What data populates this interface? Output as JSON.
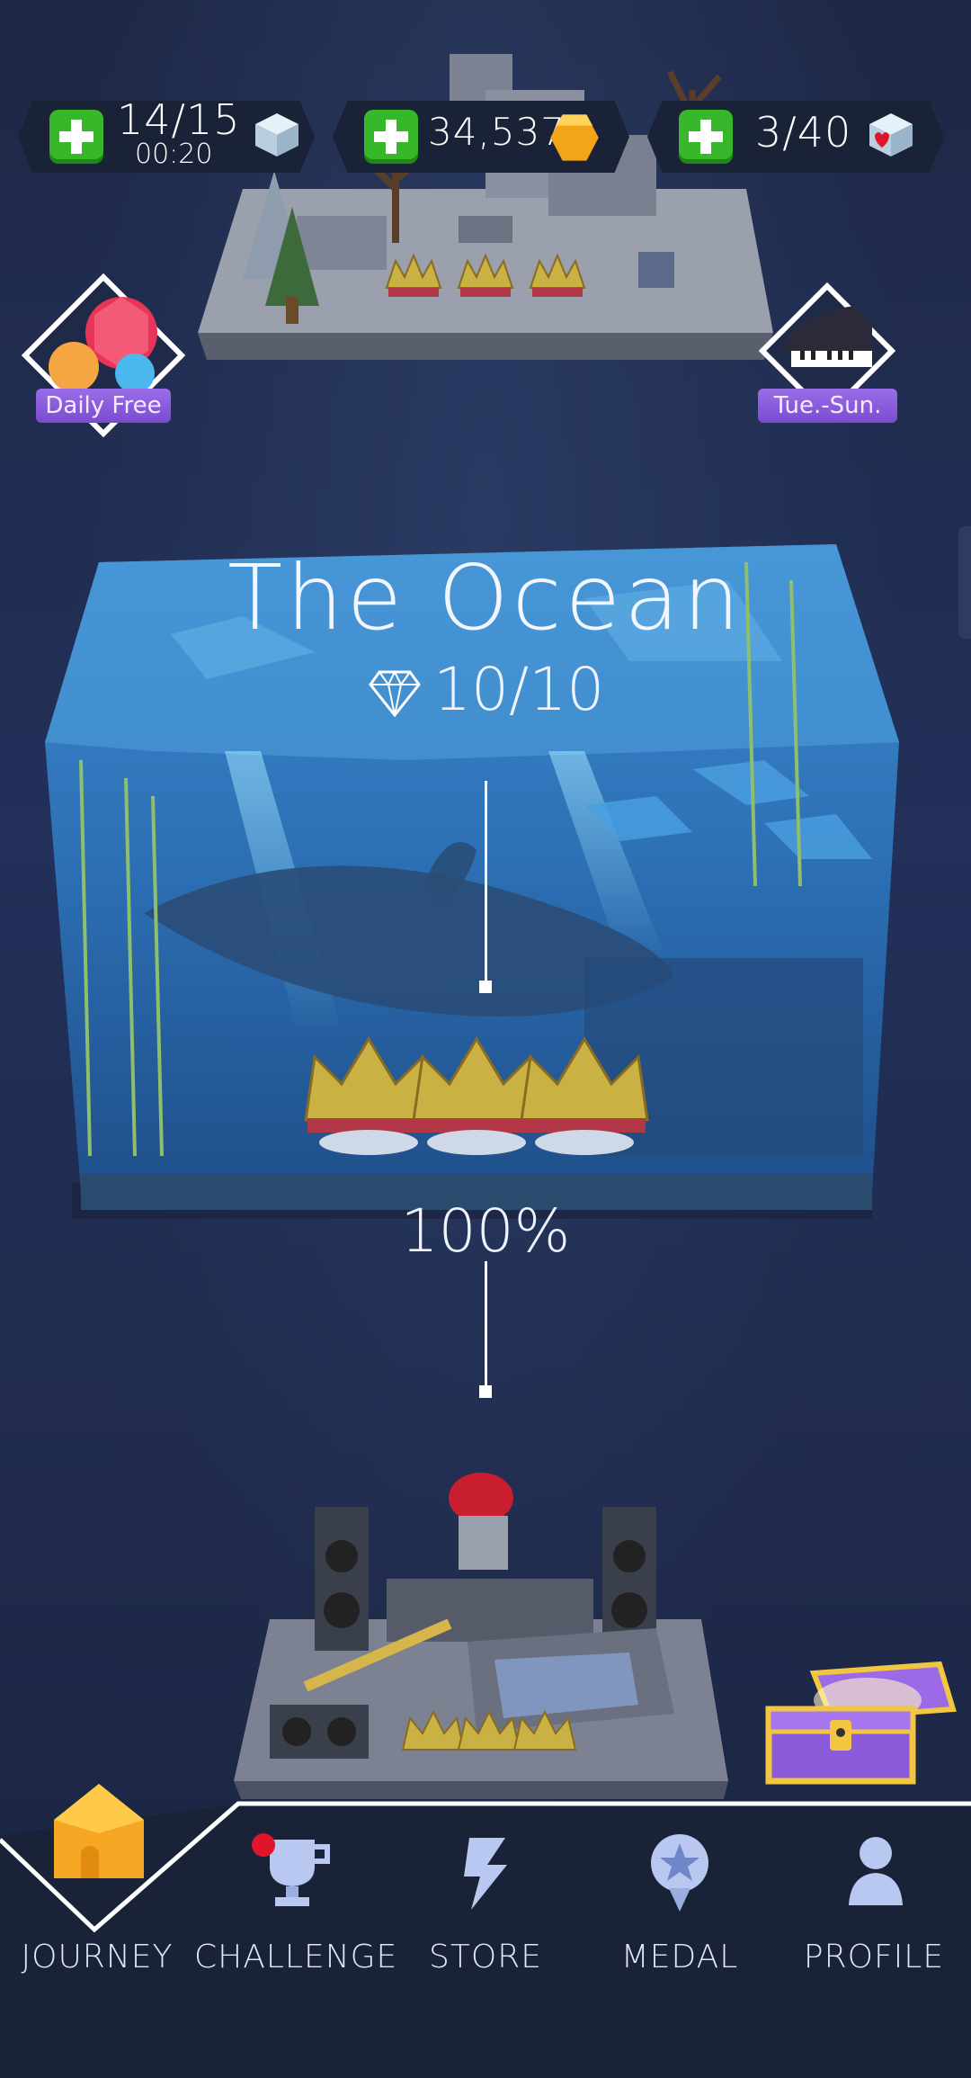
{
  "resources": {
    "energy": {
      "value": "14/15",
      "timer": "00:20"
    },
    "coins": {
      "value": "34,537"
    },
    "hearts": {
      "value": "3/40"
    }
  },
  "side_buttons": {
    "daily_free": "Daily Free",
    "schedule": "Tue.-Sun."
  },
  "level": {
    "title": "The Ocean",
    "gems": "10/10",
    "progress": "100%"
  },
  "nav": {
    "items": [
      {
        "label": "JOURNEY",
        "active": true
      },
      {
        "label": "CHALLENGE",
        "badge": true
      },
      {
        "label": "STORE"
      },
      {
        "label": "MEDAL"
      },
      {
        "label": "PROFILE"
      }
    ]
  },
  "colors": {
    "background": "#1f2a48",
    "plus_green": "#36b82a",
    "tag_purple": "#8a5ddd",
    "badge_red": "#e0142a",
    "journey_orange": "#f5a623"
  }
}
